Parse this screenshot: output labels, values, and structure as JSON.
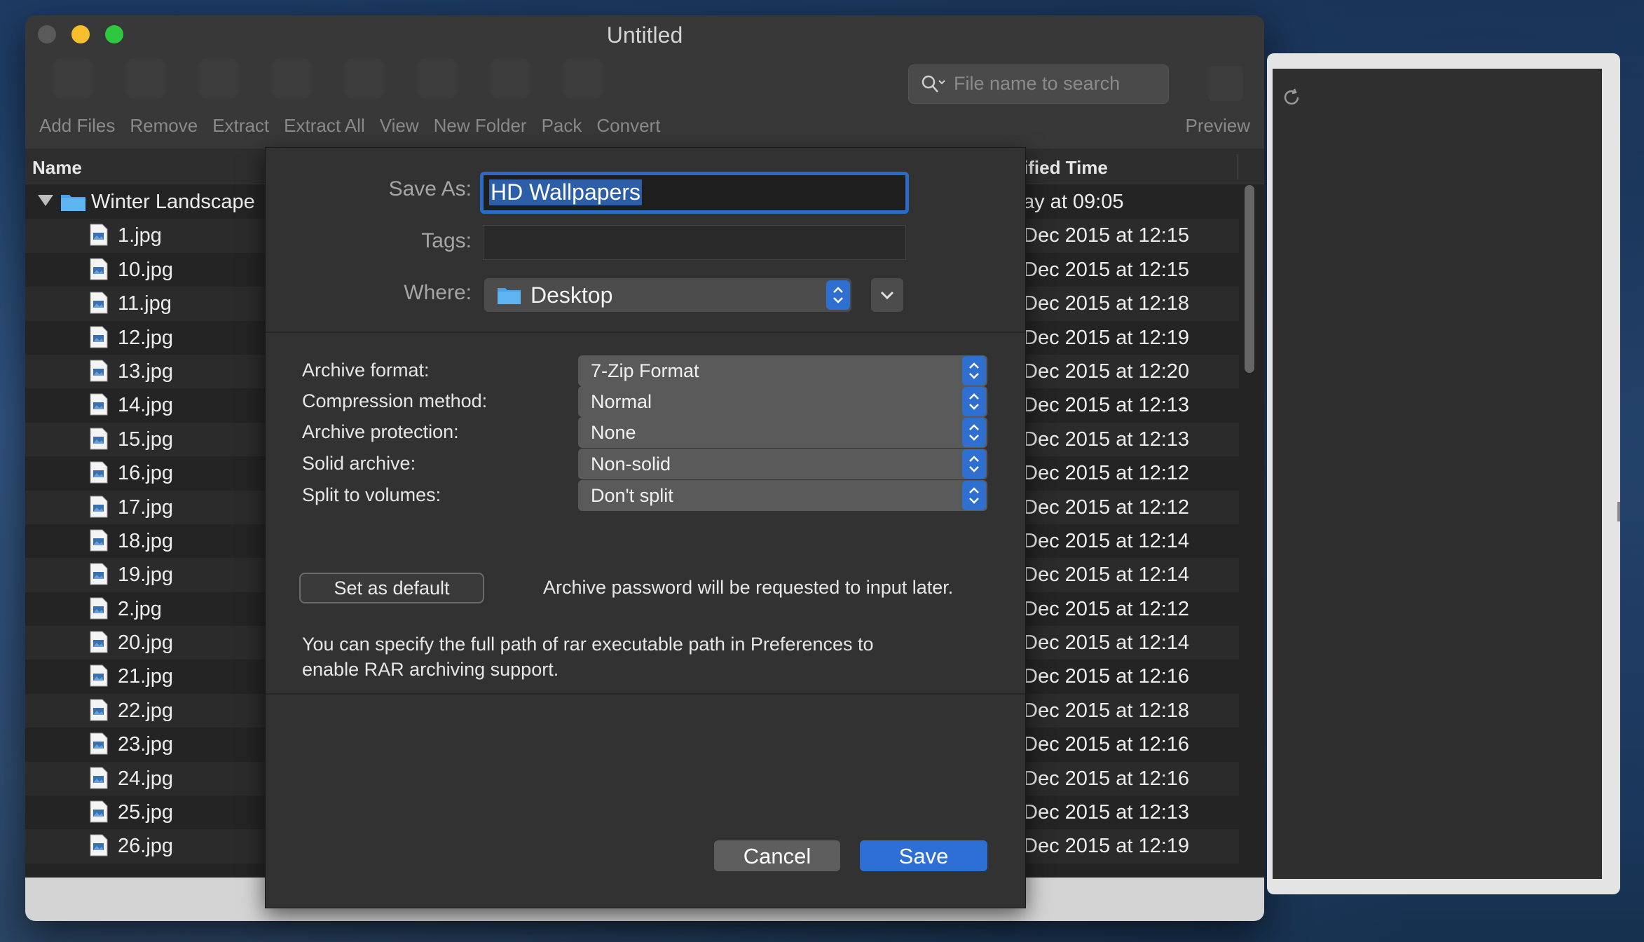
{
  "window": {
    "title": "Untitled",
    "search_placeholder": "File name to search",
    "toolbar": [
      "Add Files",
      "Remove",
      "Extract",
      "Extract All",
      "View",
      "New Folder",
      "Pack",
      "Convert"
    ],
    "preview_label": "Preview"
  },
  "file_list": {
    "columns": {
      "name": "Name",
      "modified": "ified Time"
    },
    "folder": {
      "name": "Winter Landscape",
      "date": "ay at 09:05"
    },
    "files": [
      {
        "name": "1.jpg",
        "date": "Dec 2015 at 12:15"
      },
      {
        "name": "10.jpg",
        "date": "Dec 2015 at 12:15"
      },
      {
        "name": "11.jpg",
        "date": "Dec 2015 at 12:18"
      },
      {
        "name": "12.jpg",
        "date": "Dec 2015 at 12:19"
      },
      {
        "name": "13.jpg",
        "date": "Dec 2015 at 12:20"
      },
      {
        "name": "14.jpg",
        "date": "Dec 2015 at 12:13"
      },
      {
        "name": "15.jpg",
        "date": "Dec 2015 at 12:13"
      },
      {
        "name": "16.jpg",
        "date": "Dec 2015 at 12:12"
      },
      {
        "name": "17.jpg",
        "date": "Dec 2015 at 12:12"
      },
      {
        "name": "18.jpg",
        "date": "Dec 2015 at 12:14"
      },
      {
        "name": "19.jpg",
        "date": "Dec 2015 at 12:14"
      },
      {
        "name": "2.jpg",
        "date": "Dec 2015 at 12:12"
      },
      {
        "name": "20.jpg",
        "date": "Dec 2015 at 12:14"
      },
      {
        "name": "21.jpg",
        "date": "Dec 2015 at 12:16"
      },
      {
        "name": "22.jpg",
        "date": "Dec 2015 at 12:18"
      },
      {
        "name": "23.jpg",
        "date": "Dec 2015 at 12:16"
      },
      {
        "name": "24.jpg",
        "date": "Dec 2015 at 12:16"
      },
      {
        "name": "25.jpg",
        "date": "Dec 2015 at 12:13"
      },
      {
        "name": "26.jpg",
        "date": "Dec 2015 at 12:19"
      }
    ]
  },
  "dialog": {
    "save_as_label": "Save As:",
    "save_as_value": "HD Wallpapers",
    "tags_label": "Tags:",
    "where_label": "Where:",
    "where_value": "Desktop",
    "options": [
      {
        "label": "Archive format:",
        "value": "7-Zip Format"
      },
      {
        "label": "Compression method:",
        "value": "Normal"
      },
      {
        "label": "Archive protection:",
        "value": "None"
      },
      {
        "label": "Solid archive:",
        "value": "Non-solid"
      },
      {
        "label": "Split to volumes:",
        "value": "Don't split"
      }
    ],
    "set_default_label": "Set as default",
    "password_note": "Archive password will be requested to input later.",
    "rar_note": "You can specify the full path of rar executable path in Preferences to enable RAR archiving support.",
    "cancel_label": "Cancel",
    "save_label": "Save"
  },
  "colors": {
    "accent": "#2e6fd6",
    "window_bg": "#2c2c2c",
    "sheet_bg": "#323232"
  }
}
